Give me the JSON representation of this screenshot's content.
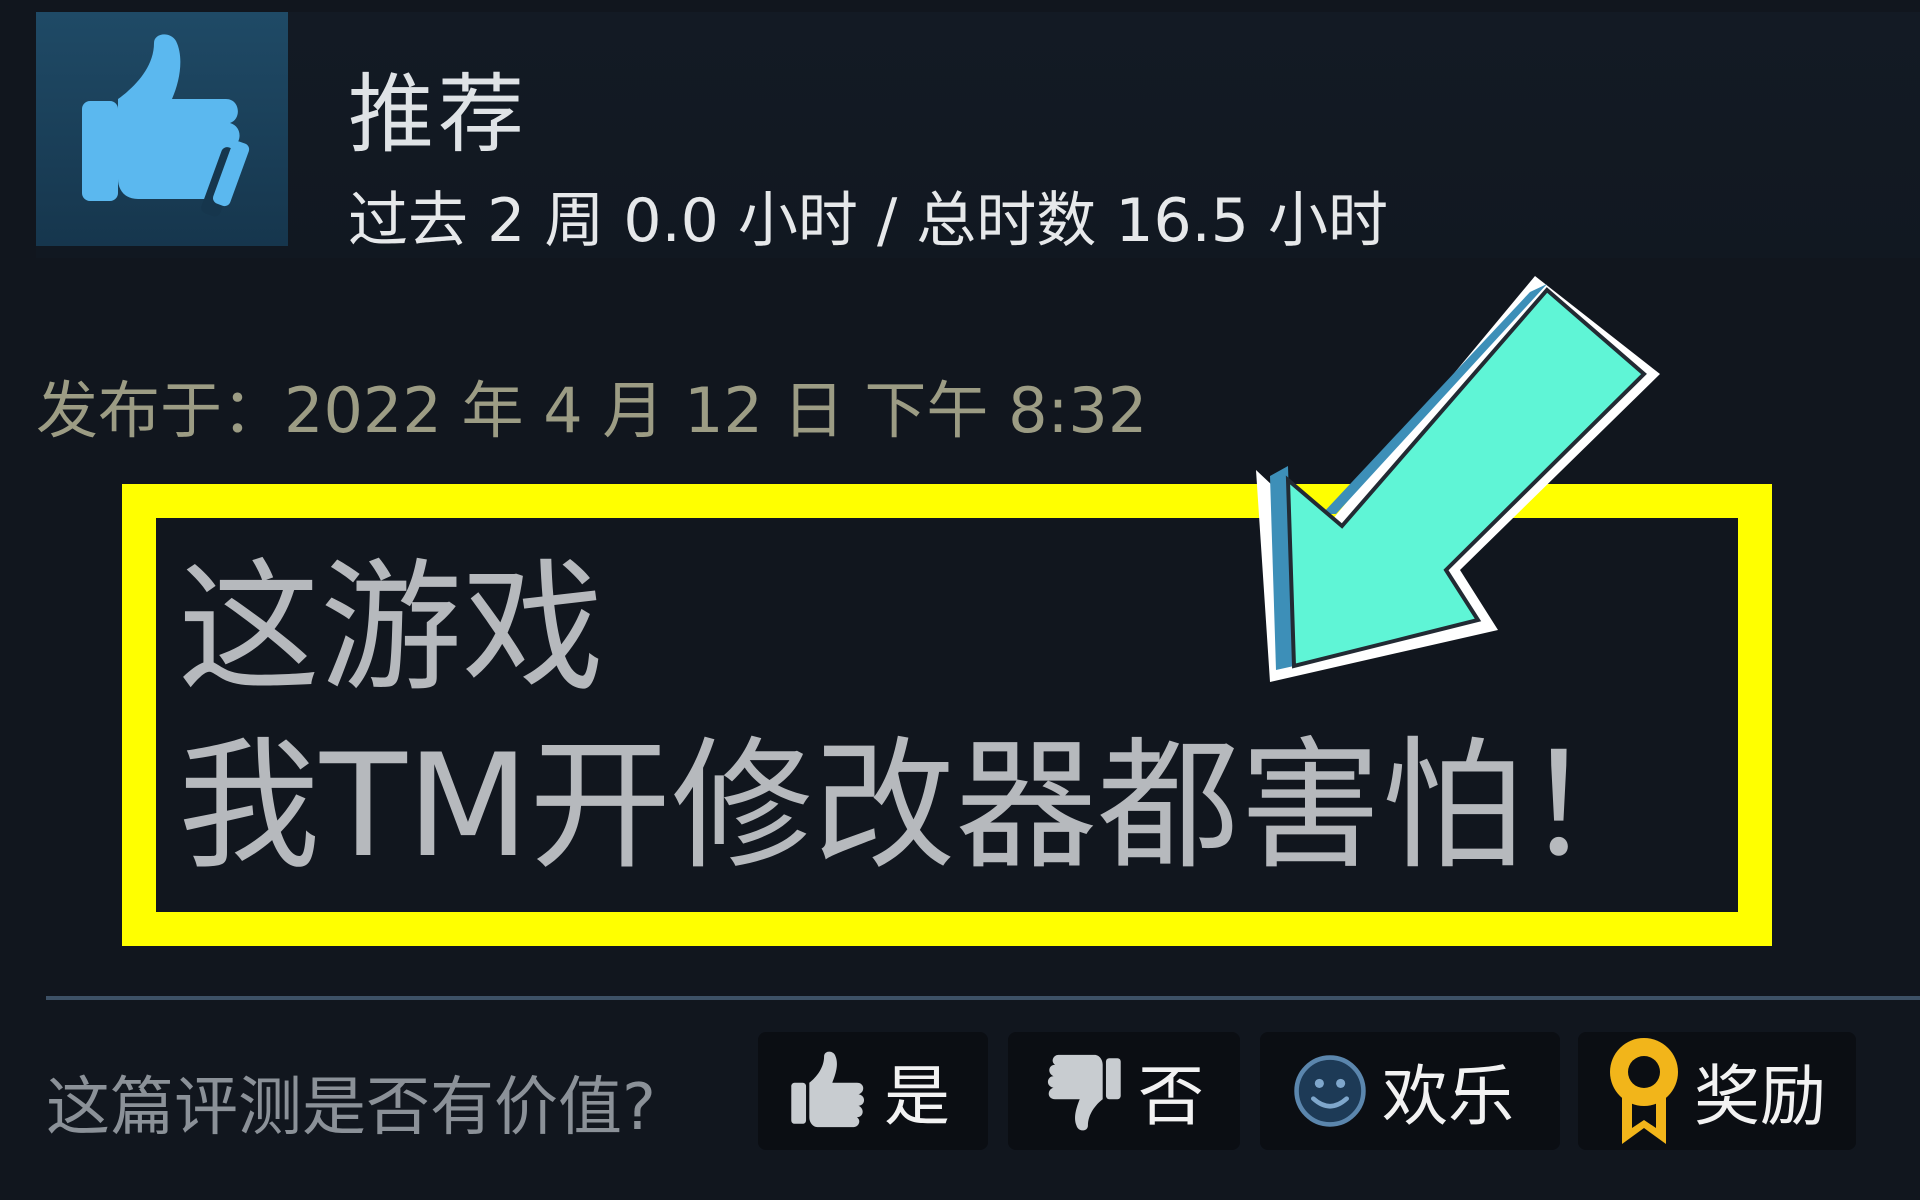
{
  "review": {
    "verdict": "推荐",
    "hours": "过去 2 周 0.0 小时 / 总时数 16.5 小时",
    "posted": "发布于：2022 年 4 月 12 日 下午 8:32",
    "text_line1": "这游戏",
    "text_line2": "我TM开修改器都害怕！"
  },
  "feedback": {
    "question": "这篇评测是否有价值?",
    "yes_label": "是",
    "no_label": "否",
    "funny_label": "欢乐",
    "award_label": "奖励"
  },
  "icons": {
    "verdict": "thumbs-up-icon",
    "yes": "thumbs-up-icon",
    "no": "thumbs-down-icon",
    "funny": "smiley-icon",
    "award": "award-ribbon-icon",
    "annotation": "arrow-icon"
  },
  "colors": {
    "background": "#11161e",
    "highlight": "#ffff00",
    "arrow": "#5ff5d6",
    "thumb_icon": "#5bb8ef",
    "award": "#f2b51a"
  }
}
